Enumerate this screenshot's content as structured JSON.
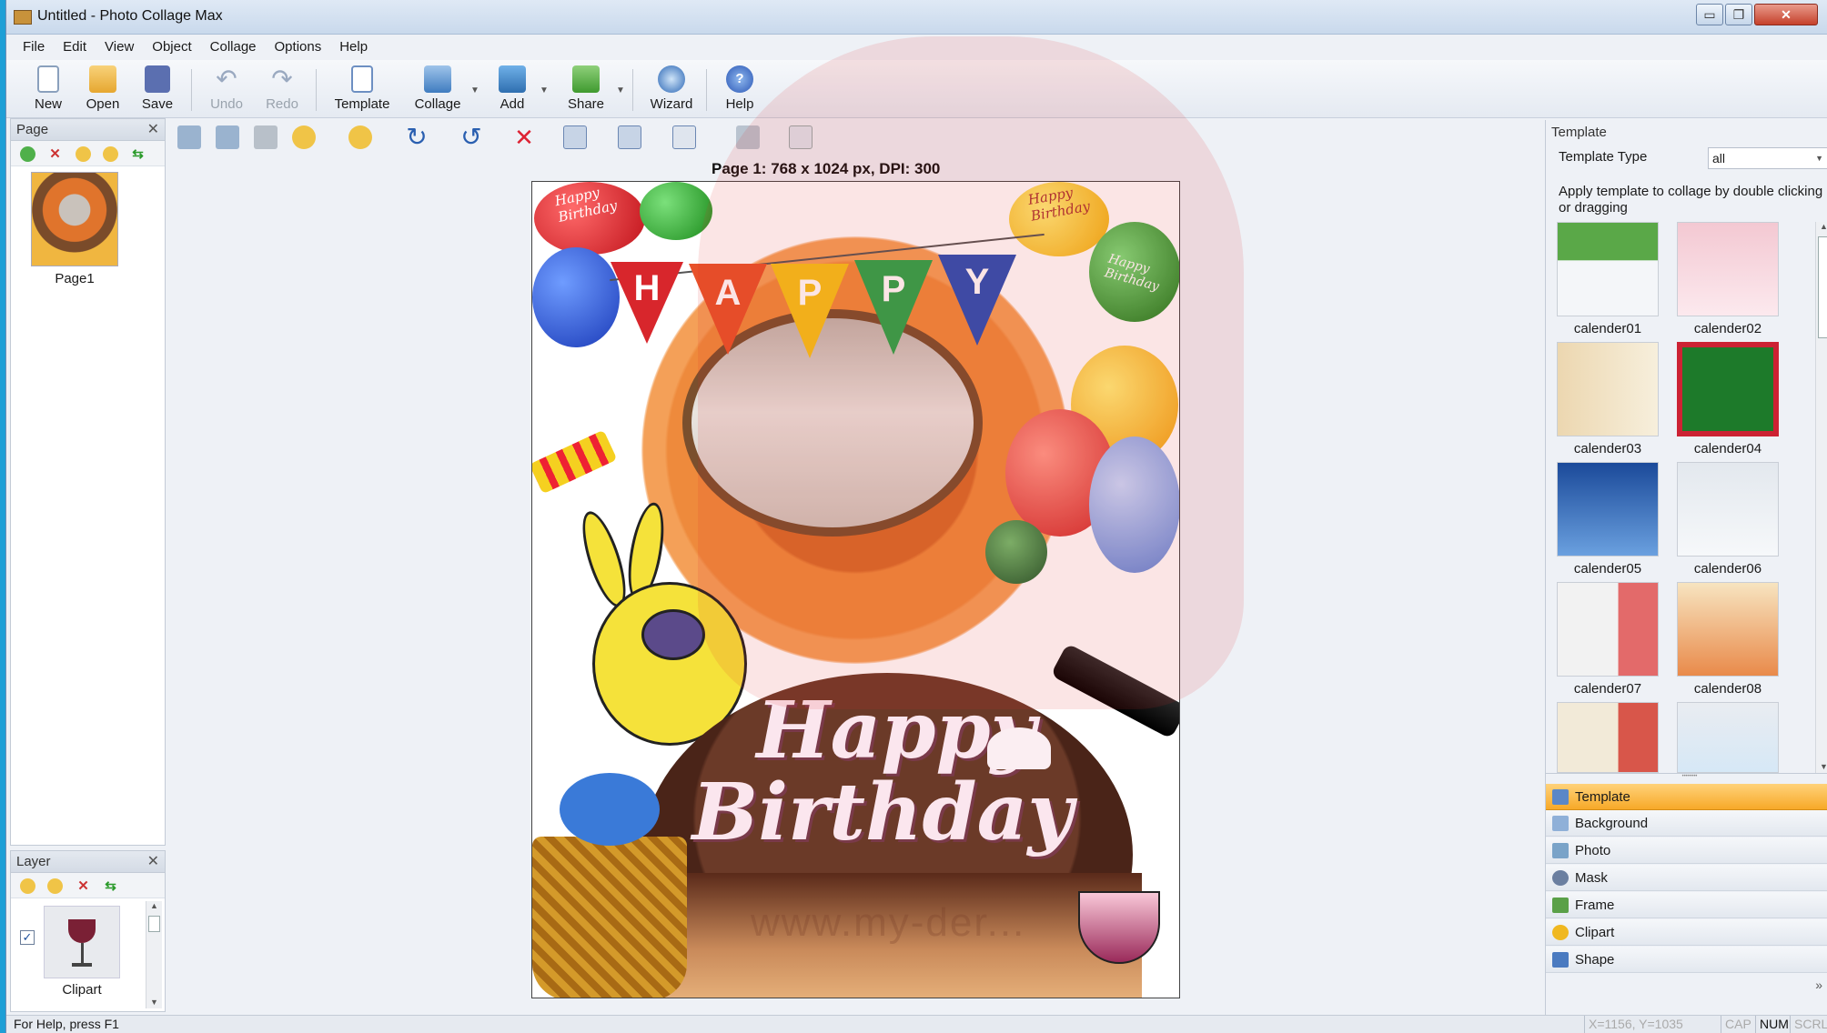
{
  "window": {
    "title": "Untitled - Photo Collage Max",
    "controls": {
      "minimize": "▭",
      "maximize": "❐",
      "close": "✕"
    }
  },
  "menu": [
    "File",
    "Edit",
    "View",
    "Object",
    "Collage",
    "Options",
    "Help"
  ],
  "toolbar": [
    {
      "label": "New",
      "icon": "new-document-icon",
      "enabled": true
    },
    {
      "label": "Open",
      "icon": "open-folder-icon",
      "enabled": true
    },
    {
      "label": "Save",
      "icon": "save-disk-icon",
      "enabled": true
    },
    {
      "label": "Undo",
      "icon": "undo-arrow-icon",
      "enabled": false
    },
    {
      "label": "Redo",
      "icon": "redo-arrow-icon",
      "enabled": false
    },
    {
      "label": "Template",
      "icon": "template-icon",
      "enabled": true
    },
    {
      "label": "Collage",
      "icon": "collage-icon",
      "enabled": true
    },
    {
      "label": "Add",
      "icon": "add-photo-icon",
      "enabled": true
    },
    {
      "label": "Share",
      "icon": "share-icon",
      "enabled": true
    },
    {
      "label": "Wizard",
      "icon": "wizard-icon",
      "enabled": true
    },
    {
      "label": "Help",
      "icon": "help-icon",
      "enabled": true
    }
  ],
  "page_panel": {
    "title": "Page",
    "close": "✕",
    "pages": [
      {
        "label": "Page1"
      }
    ]
  },
  "layer_panel": {
    "title": "Layer",
    "close": "✕",
    "layers": [
      {
        "label": "Clipart",
        "checked": true
      }
    ]
  },
  "canvas": {
    "page_label": "Page 1: 768 x 1024 px, DPI: 300",
    "banner_letters": [
      "H",
      "A",
      "P",
      "P",
      "Y"
    ],
    "balloon_text": [
      "Happy Birthday",
      "Happy Birthday",
      "Happy Birthday"
    ],
    "cake_text": [
      "Happy",
      "Birthday"
    ]
  },
  "template_panel": {
    "title": "Template",
    "type_label": "Template Type",
    "type_value": "all",
    "hint": "Apply template to collage by double clicking or dragging",
    "templates": [
      "calender01",
      "calender02",
      "calender03",
      "calender04",
      "calender05",
      "calender06",
      "calender07",
      "calender08"
    ],
    "categories": [
      {
        "label": "Template",
        "icon": "template-icon",
        "active": true
      },
      {
        "label": "Background",
        "icon": "background-icon",
        "active": false
      },
      {
        "label": "Photo",
        "icon": "photo-icon",
        "active": false
      },
      {
        "label": "Mask",
        "icon": "mask-icon",
        "active": false
      },
      {
        "label": "Frame",
        "icon": "frame-icon",
        "active": false
      },
      {
        "label": "Clipart",
        "icon": "clipart-icon",
        "active": false
      },
      {
        "label": "Shape",
        "icon": "shape-icon",
        "active": false
      }
    ],
    "expand": "»"
  },
  "status": {
    "help": "For Help, press F1",
    "coords": "X=1156, Y=1035",
    "cap": "CAP",
    "num": "NUM",
    "scrl": "SCRL"
  },
  "watermark": "www.my-der..."
}
